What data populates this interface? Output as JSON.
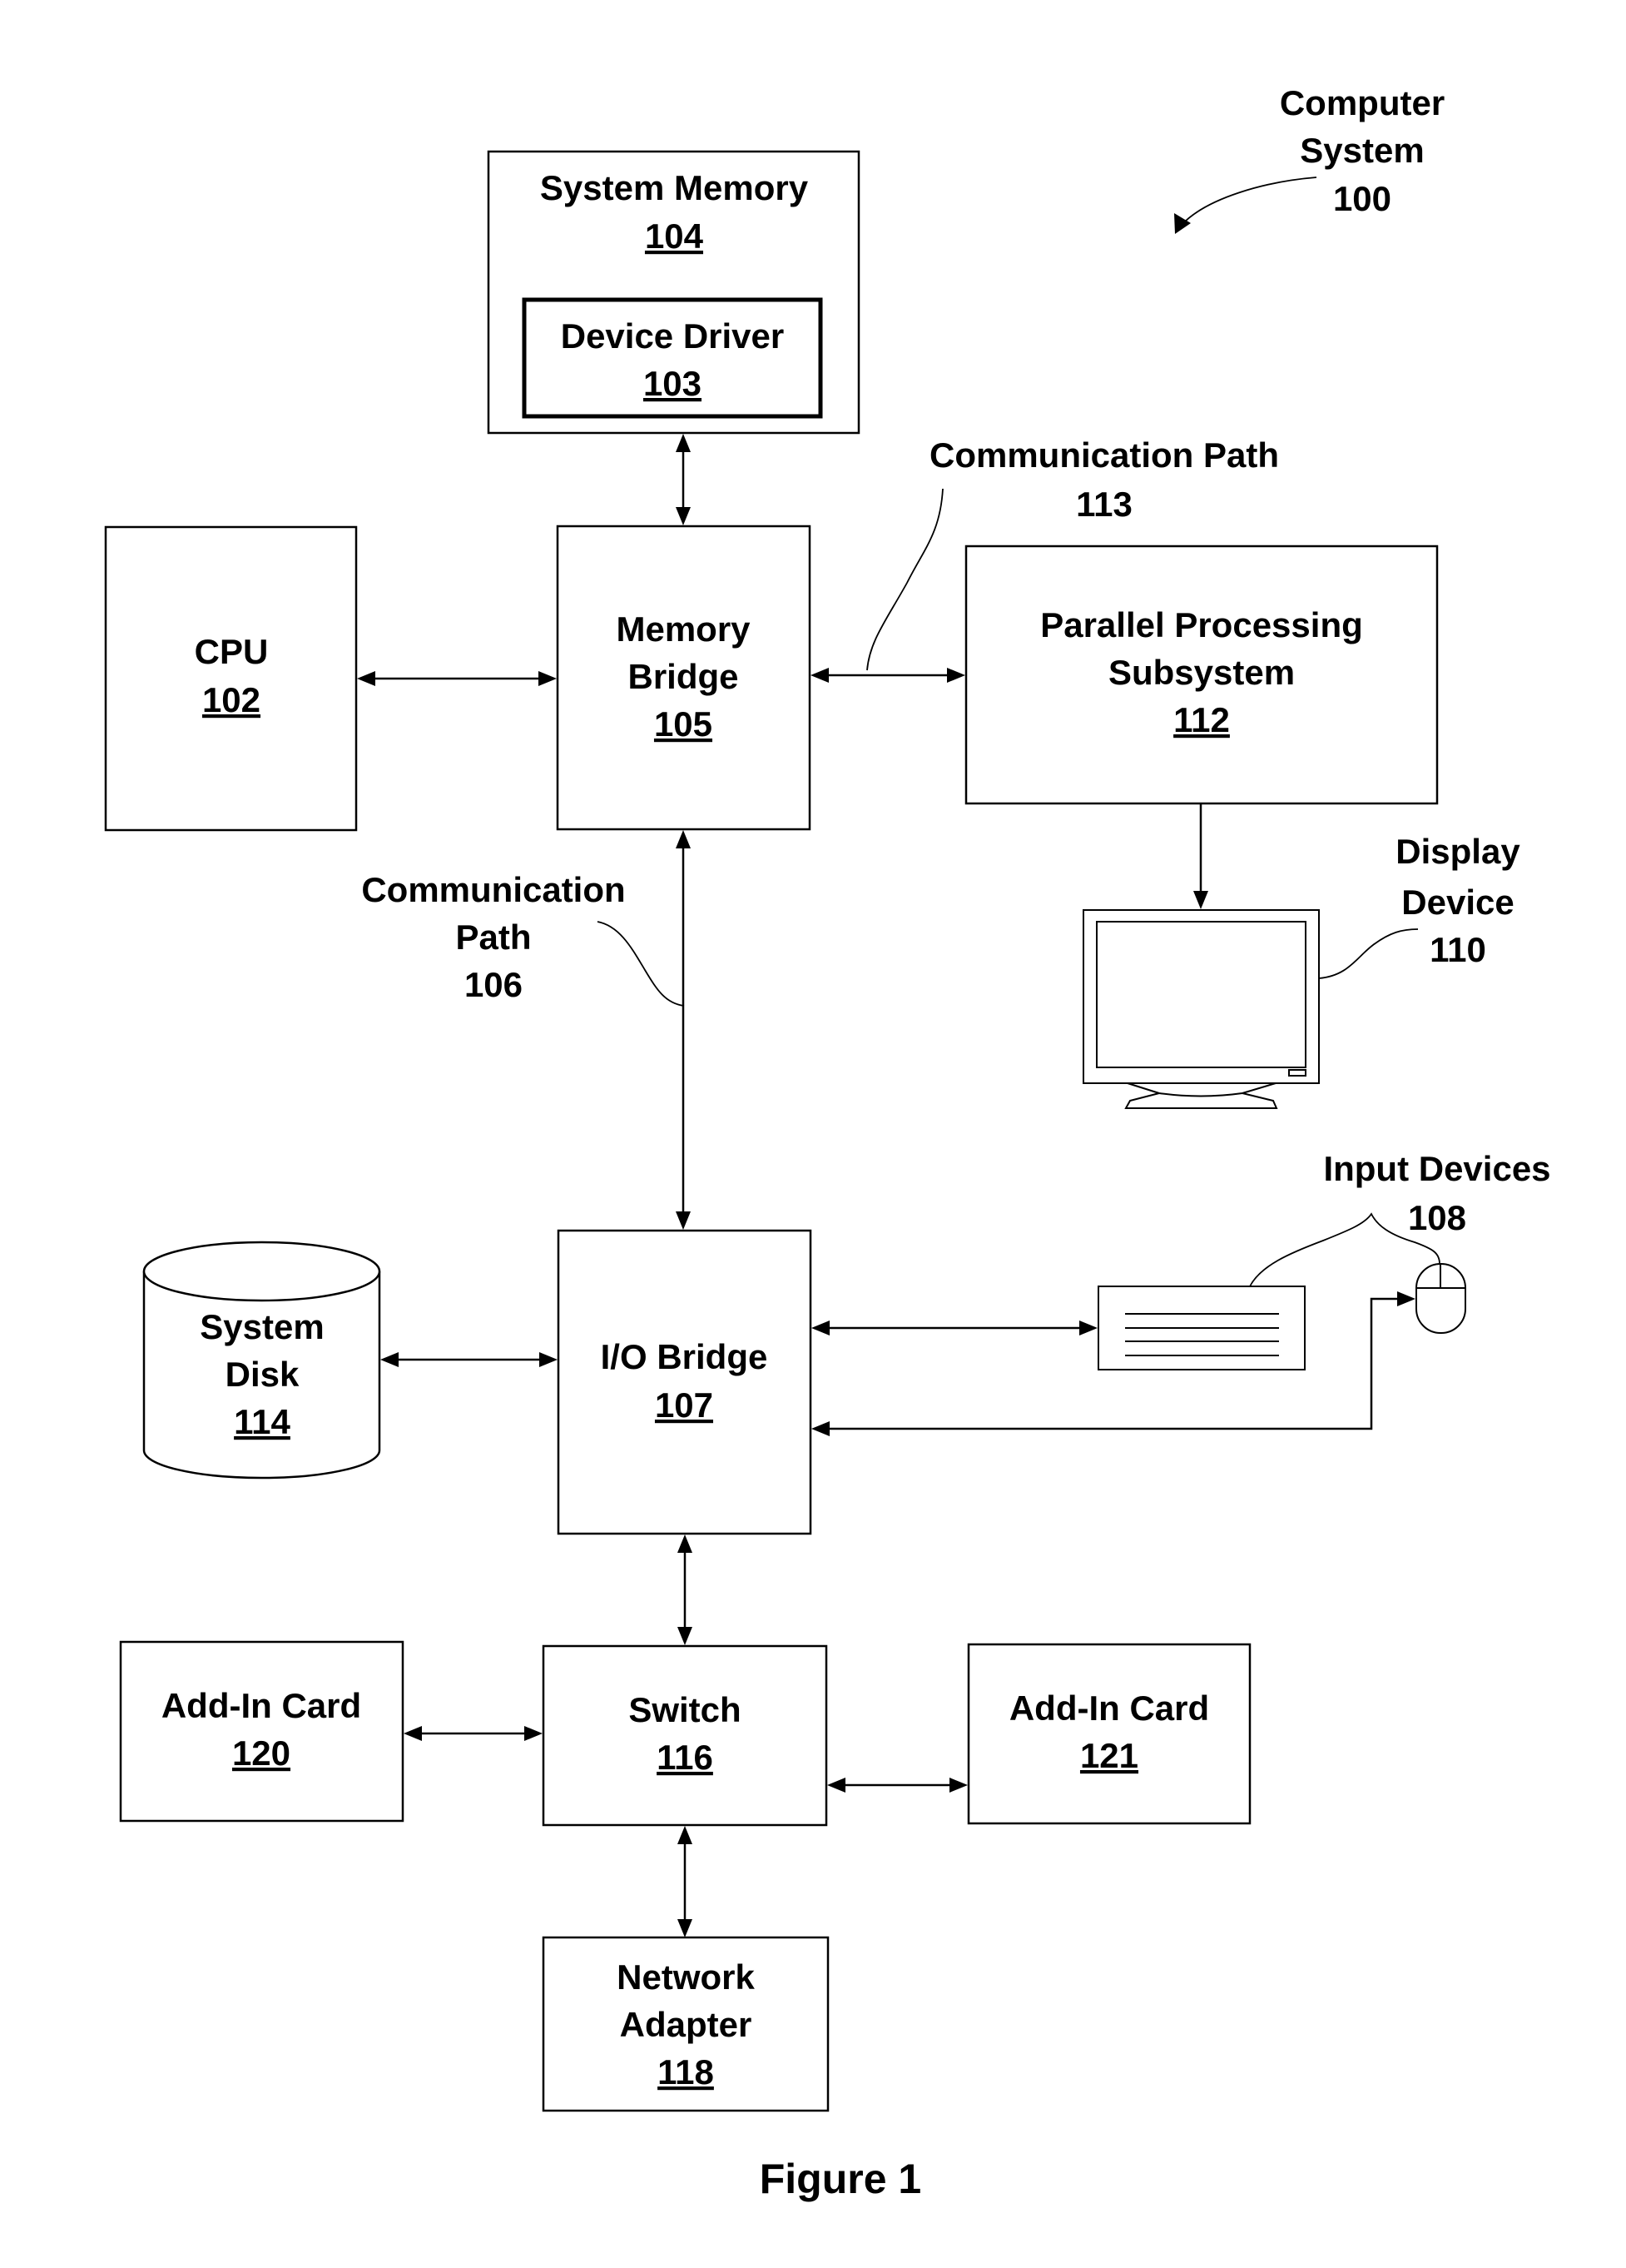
{
  "figure": {
    "caption": "Figure 1",
    "system_label": [
      "Computer",
      "System",
      "100"
    ]
  },
  "blocks": {
    "system_memory": {
      "name": "System Memory",
      "ref": "104"
    },
    "device_driver": {
      "name": "Device Driver",
      "ref": "103"
    },
    "cpu": {
      "name": "CPU",
      "ref": "102"
    },
    "memory_bridge": {
      "name_lines": [
        "Memory",
        "Bridge"
      ],
      "ref": "105"
    },
    "parallel_processing": {
      "name_lines": [
        "Parallel Processing",
        "Subsystem"
      ],
      "ref": "112"
    },
    "io_bridge": {
      "name": "I/O Bridge",
      "ref": "107"
    },
    "system_disk": {
      "name_lines": [
        "System",
        "Disk"
      ],
      "ref": "114"
    },
    "switch": {
      "name": "Switch",
      "ref": "116"
    },
    "add_in_card_120": {
      "name": "Add-In Card",
      "ref": "120"
    },
    "add_in_card_121": {
      "name": "Add-In Card",
      "ref": "121"
    },
    "network_adapter": {
      "name_lines": [
        "Network",
        "Adapter"
      ],
      "ref": "118"
    }
  },
  "callouts": {
    "comm_path_113": [
      "Communication Path",
      "113"
    ],
    "comm_path_106": [
      "Communication",
      "Path",
      "106"
    ],
    "display_device": [
      "Display",
      "Device",
      "110"
    ],
    "input_devices": [
      "Input Devices",
      "108"
    ]
  },
  "icons": {
    "display": "monitor-icon",
    "keyboard": "keyboard-icon",
    "mouse": "mouse-icon",
    "disk": "cylinder-disk-icon"
  },
  "connections": [
    {
      "from": "system_memory",
      "to": "memory_bridge",
      "type": "bidirectional"
    },
    {
      "from": "cpu",
      "to": "memory_bridge",
      "type": "bidirectional"
    },
    {
      "from": "memory_bridge",
      "to": "parallel_processing",
      "type": "bidirectional",
      "label": "113"
    },
    {
      "from": "parallel_processing",
      "to": "display_device",
      "type": "unidirectional"
    },
    {
      "from": "memory_bridge",
      "to": "io_bridge",
      "type": "bidirectional",
      "label": "106"
    },
    {
      "from": "system_disk",
      "to": "io_bridge",
      "type": "bidirectional"
    },
    {
      "from": "io_bridge",
      "to": "keyboard",
      "type": "bidirectional"
    },
    {
      "from": "mouse",
      "to": "io_bridge",
      "type": "bidirectional"
    },
    {
      "from": "io_bridge",
      "to": "switch",
      "type": "bidirectional"
    },
    {
      "from": "add_in_card_120",
      "to": "switch",
      "type": "bidirectional"
    },
    {
      "from": "switch",
      "to": "add_in_card_121",
      "type": "bidirectional"
    },
    {
      "from": "switch",
      "to": "network_adapter",
      "type": "bidirectional"
    }
  ]
}
